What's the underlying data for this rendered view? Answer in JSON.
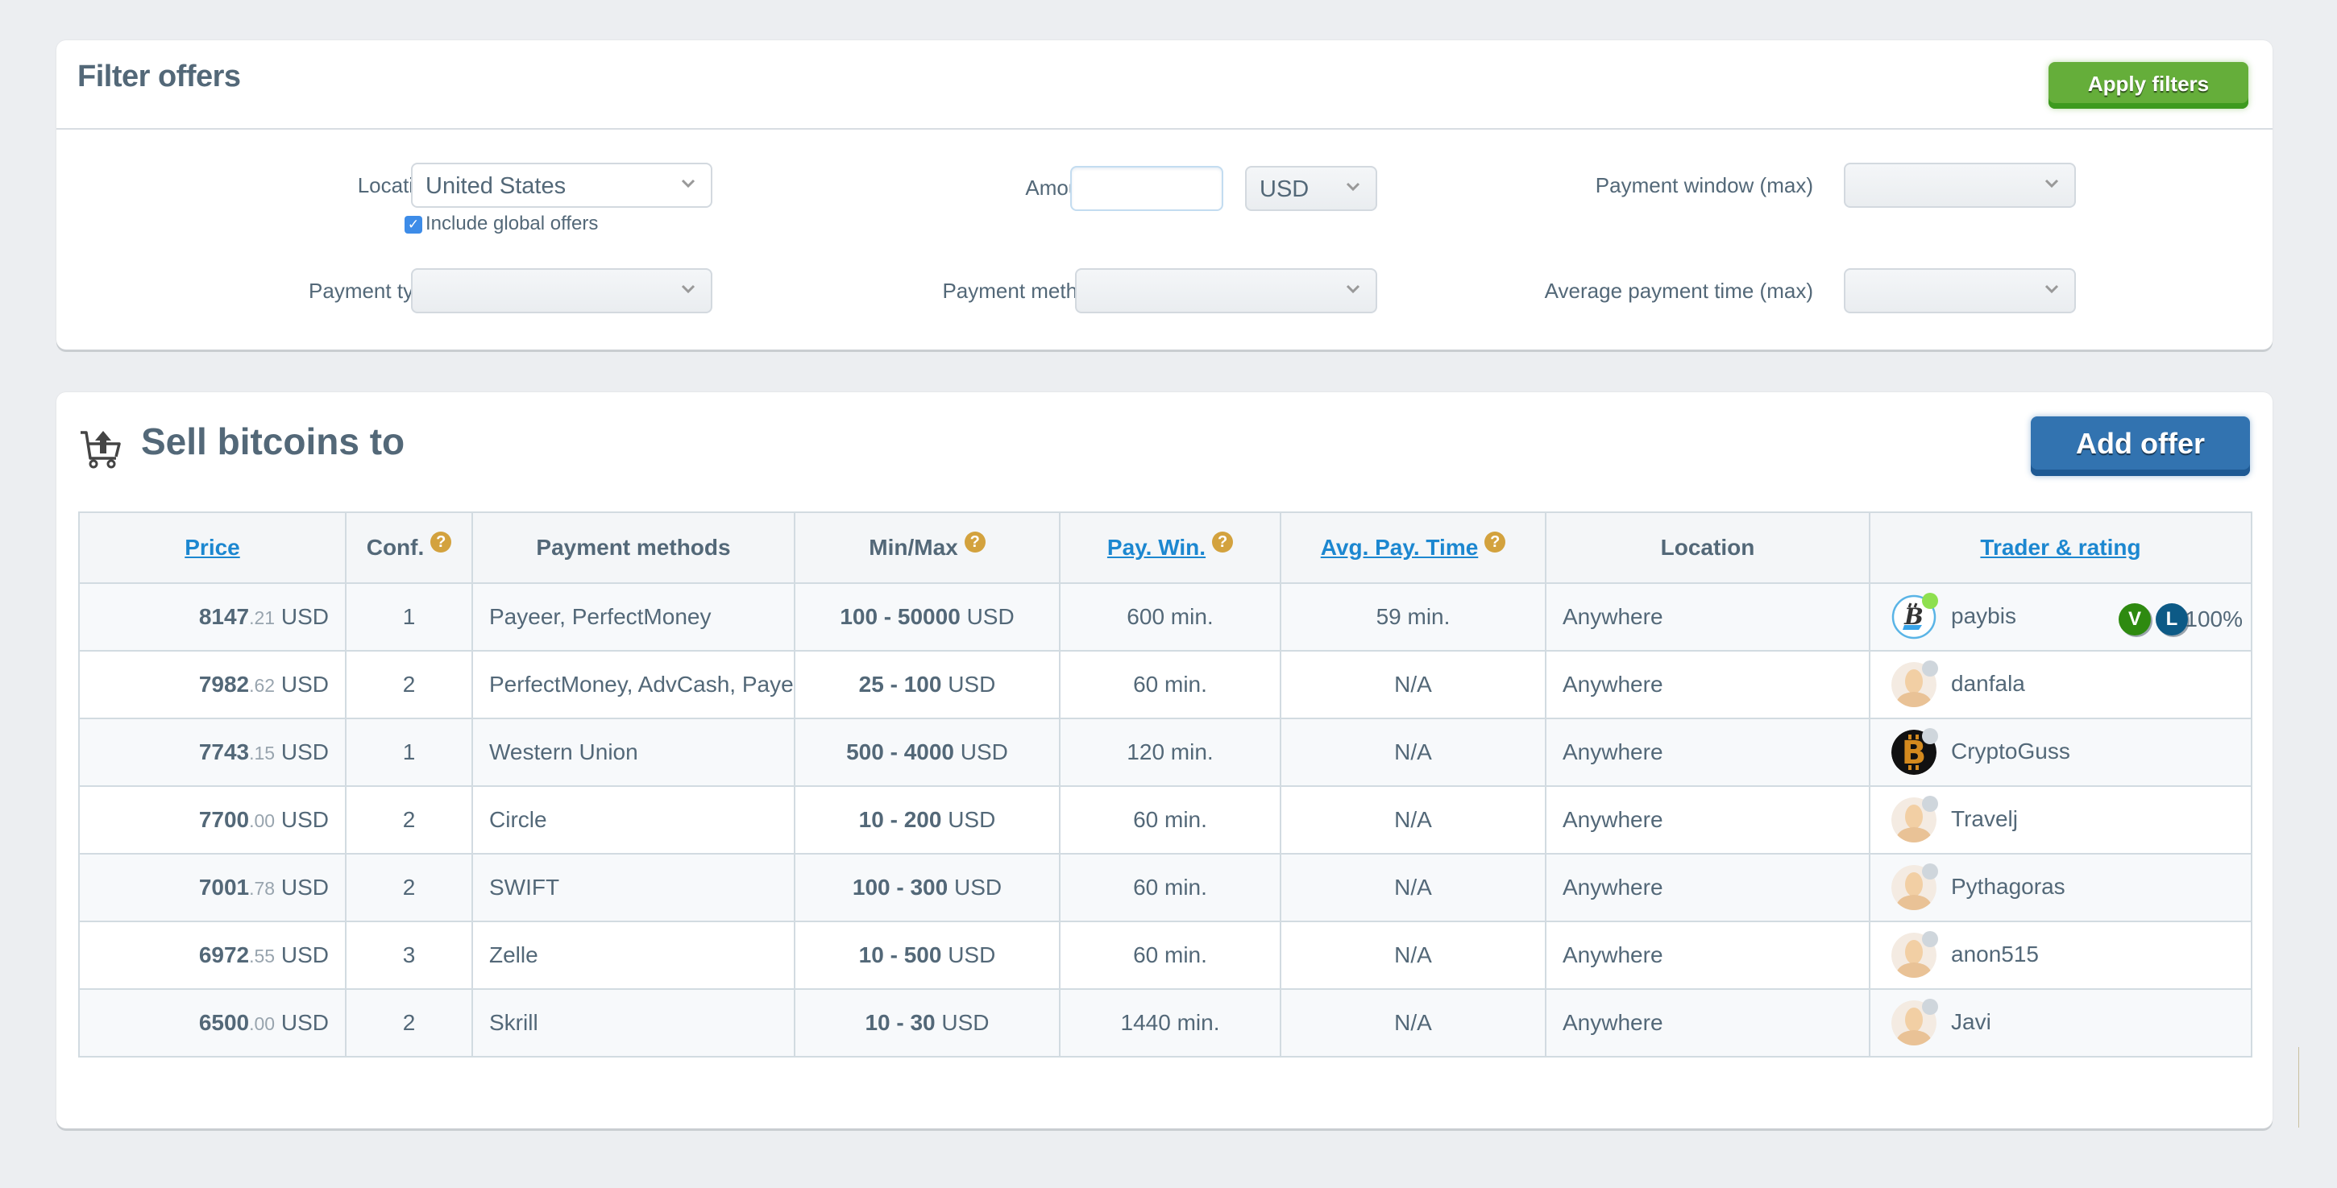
{
  "filter": {
    "title": "Filter offers",
    "apply_label": "Apply filters",
    "location_label": "Location",
    "location_value": "United States",
    "include_global_label": "Include global offers",
    "include_global_checked": true,
    "amount_label": "Amount",
    "amount_value": "",
    "currency_value": "USD",
    "payment_window_label": "Payment window (max)",
    "payment_window_value": "",
    "payment_type_label": "Payment type",
    "payment_type_value": "",
    "payment_method_label": "Payment method",
    "payment_method_value": "",
    "avg_payment_time_label": "Average payment time (max)",
    "avg_payment_time_value": ""
  },
  "sell": {
    "title": "Sell bitcoins to",
    "add_offer_label": "Add offer",
    "icon": "cart-upload-icon",
    "columns": [
      {
        "label": "Price",
        "sortable": true,
        "help": false
      },
      {
        "label": "Conf.",
        "sortable": false,
        "help": true
      },
      {
        "label": "Payment methods",
        "sortable": false,
        "help": false
      },
      {
        "label": "Min/Max",
        "sortable": false,
        "help": true
      },
      {
        "label": "Pay. Win.",
        "sortable": true,
        "help": true
      },
      {
        "label": "Avg. Pay. Time",
        "sortable": true,
        "help": true
      },
      {
        "label": "Location",
        "sortable": false,
        "help": false
      },
      {
        "label": "Trader & rating",
        "sortable": true,
        "help": false
      }
    ],
    "help_glyph": "?",
    "rows": [
      {
        "price_int": "8147",
        "price_dec": ".21",
        "currency": "USD",
        "conf": "1",
        "methods": "Payeer, PerfectMoney",
        "min_max": "100 - 50000",
        "min_max_currency": "USD",
        "pay_win": "600 min.",
        "avg_pay_time": "59 min.",
        "location": "Anywhere",
        "trader": "paybis",
        "avatar": "paybis-logo",
        "online": true,
        "badges": [
          "V",
          "L"
        ],
        "rating": "100%"
      },
      {
        "price_int": "7982",
        "price_dec": ".62",
        "currency": "USD",
        "conf": "2",
        "methods": "PerfectMoney, AdvCash, Payee",
        "min_max": "25 - 100",
        "min_max_currency": "USD",
        "pay_win": "60 min.",
        "avg_pay_time": "N/A",
        "location": "Anywhere",
        "trader": "danfala",
        "avatar": "default-avatar",
        "online": false
      },
      {
        "price_int": "7743",
        "price_dec": ".15",
        "currency": "USD",
        "conf": "1",
        "methods": "Western Union",
        "min_max": "500 - 4000",
        "min_max_currency": "USD",
        "pay_win": "120 min.",
        "avg_pay_time": "N/A",
        "location": "Anywhere",
        "trader": "CryptoGuss",
        "avatar": "bitcoin-logo",
        "online": false
      },
      {
        "price_int": "7700",
        "price_dec": ".00",
        "currency": "USD",
        "conf": "2",
        "methods": "Circle",
        "min_max": "10 - 200",
        "min_max_currency": "USD",
        "pay_win": "60 min.",
        "avg_pay_time": "N/A",
        "location": "Anywhere",
        "trader": "Travelj",
        "avatar": "default-avatar",
        "online": false
      },
      {
        "price_int": "7001",
        "price_dec": ".78",
        "currency": "USD",
        "conf": "2",
        "methods": "SWIFT",
        "min_max": "100 - 300",
        "min_max_currency": "USD",
        "pay_win": "60 min.",
        "avg_pay_time": "N/A",
        "location": "Anywhere",
        "trader": "Pythagoras",
        "avatar": "default-avatar",
        "online": false
      },
      {
        "price_int": "6972",
        "price_dec": ".55",
        "currency": "USD",
        "conf": "3",
        "methods": "Zelle",
        "min_max": "10 - 500",
        "min_max_currency": "USD",
        "pay_win": "60 min.",
        "avg_pay_time": "N/A",
        "location": "Anywhere",
        "trader": "anon515",
        "avatar": "default-avatar",
        "online": false
      },
      {
        "price_int": "6500",
        "price_dec": ".00",
        "currency": "USD",
        "conf": "2",
        "methods": "Skrill",
        "min_max": "10 - 30",
        "min_max_currency": "USD",
        "pay_win": "1440 min.",
        "avg_pay_time": "N/A",
        "location": "Anywhere",
        "trader": "Javi",
        "avatar": "default-avatar",
        "online": false
      }
    ]
  },
  "colors": {
    "apply_green": "#65ae3a",
    "add_blue": "#3273b0",
    "link_blue": "#1c87d0",
    "help_gold": "#d3a23e",
    "online_green": "#8ee04f",
    "offline_gray": "#cfd6dc",
    "badge_v": "#2e8a10",
    "badge_l": "#0d5a86"
  }
}
